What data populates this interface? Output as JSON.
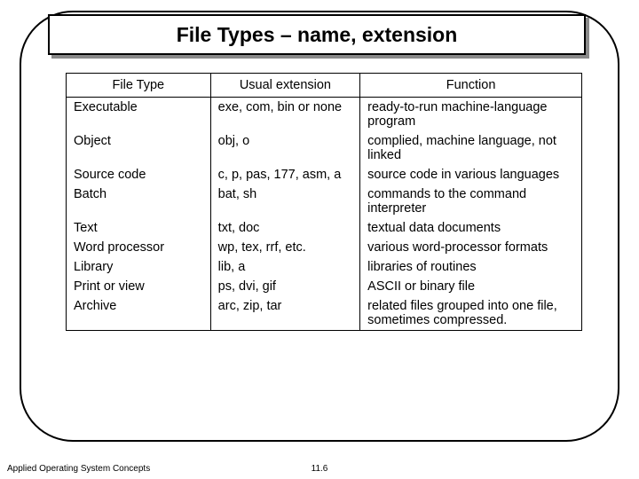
{
  "title": "File Types – name, extension",
  "headers": [
    "File Type",
    "Usual extension",
    "Function"
  ],
  "rows": [
    {
      "type": "Executable",
      "ext": "exe, com, bin or none",
      "func": "ready-to-run machine-language program"
    },
    {
      "type": "Object",
      "ext": "obj, o",
      "func": "complied, machine language, not linked"
    },
    {
      "type": "Source code",
      "ext": "c, p, pas, 177, asm, a",
      "func": "source code in various languages"
    },
    {
      "type": "Batch",
      "ext": "bat, sh",
      "func": "commands to the command interpreter"
    },
    {
      "type": "Text",
      "ext": "txt, doc",
      "func": "textual data documents"
    },
    {
      "type": "Word processor",
      "ext": "wp, tex, rrf, etc.",
      "func": "various word-processor formats"
    },
    {
      "type": "Library",
      "ext": "lib, a",
      "func": "libraries of routines"
    },
    {
      "type": "Print or view",
      "ext": "ps, dvi, gif",
      "func": "ASCII or binary file"
    },
    {
      "type": "Archive",
      "ext": "arc, zip, tar",
      "func": "related files grouped into one file, sometimes compressed."
    }
  ],
  "footer": {
    "left": "Applied Operating System Concepts",
    "center": "11.6"
  }
}
